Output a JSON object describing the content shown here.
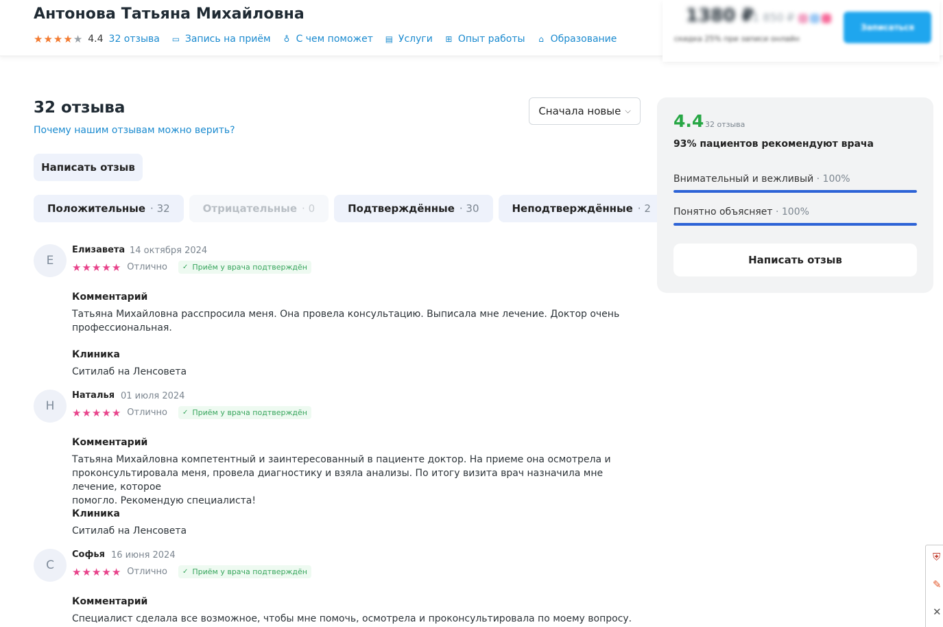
{
  "header": {
    "doctor_name": "Антонова Татьяна Михайловна",
    "rating": "4.4",
    "rating_stars": 4.4,
    "nav": [
      {
        "label": "32 отзыва",
        "icon": ""
      },
      {
        "label": "Запись на приём",
        "icon": "calendar-icon"
      },
      {
        "label": "С чем поможет",
        "icon": "stethoscope-icon"
      },
      {
        "label": "Услуги",
        "icon": "document-icon"
      },
      {
        "label": "Опыт работы",
        "icon": "medical-case-icon"
      },
      {
        "label": "Образование",
        "icon": "graduation-cap-icon"
      }
    ],
    "accent_color": "#1a8acf"
  },
  "promo": {
    "price": "1380 ₽",
    "price_old": "1 850 ₽",
    "note": "скидка 25% при записи онлайн",
    "button_label": "Записаться"
  },
  "reviews": {
    "title": "32 отзыва",
    "trust_link": "Почему нашим отзывам можно верить?",
    "sort_label": "Сначала новые",
    "write_button": "Написать отзыв",
    "filters": [
      {
        "label": "Положительные",
        "count": "· 32",
        "disabled": false
      },
      {
        "label": "Отрицательные",
        "count": "· 0",
        "disabled": true
      },
      {
        "label": "Подтверждённые",
        "count": "· 30",
        "disabled": false
      },
      {
        "label": "Неподтверждённые",
        "count": "· 2",
        "disabled": false
      }
    ],
    "items": [
      {
        "initial": "Е",
        "name": "Елизавета",
        "date": "14 октября 2024",
        "stars": 5,
        "verdict": "Отлично",
        "badge": "Приём у врача подтверждён",
        "comment_label": "Комментарий",
        "comment_lines": [
          "Татьяна Михайловна расспросила меня. Она провела консультацию. Выписала мне лечение. Доктор очень",
          "профессиональная."
        ],
        "clinic_label": "Клиника",
        "clinic": "Ситилаб на Ленсовета"
      },
      {
        "initial": "Н",
        "name": "Наталья",
        "date": "01 июля 2024",
        "stars": 5,
        "verdict": "Отлично",
        "badge": "Приём у врача подтверждён",
        "comment_label": "Комментарий",
        "comment_lines": [
          "Татьяна Михайловна компетентный и заинтересованный в пациенте доктор. На приеме она осмотрела и",
          "проконсультировала меня, провела диагностику и взяла анализы. По итогу визита врач назначила мне лечение, которое",
          "помогло. Рекомендую специалиста!"
        ],
        "clinic_label": "Клиника",
        "clinic": "Ситилаб на Ленсовета"
      },
      {
        "initial": "С",
        "name": "Софья",
        "date": "16 июня 2024",
        "stars": 5,
        "verdict": "Отлично",
        "badge": "Приём у врача подтверждён",
        "comment_label": "Комментарий",
        "comment_lines": [
          "Специалист сделала все возможное, чтобы мне помочь, осмотрела и проконсультировала по моему вопросу. По итогу мне"
        ],
        "clinic_label": "",
        "clinic": ""
      }
    ]
  },
  "summary": {
    "rating": "4.4",
    "count": "32 отзыва",
    "recommend": "93% пациентов рекомендуют врача",
    "metrics": [
      {
        "label": "Внимательный и вежливый",
        "pct_text": "· 100%",
        "pct": 100
      },
      {
        "label": "Понятно объясняет",
        "pct_text": "· 100%",
        "pct": 100
      }
    ],
    "write_button": "Написать отзыв",
    "rating_color": "#28a745",
    "bar_color": "#2d63d6"
  }
}
